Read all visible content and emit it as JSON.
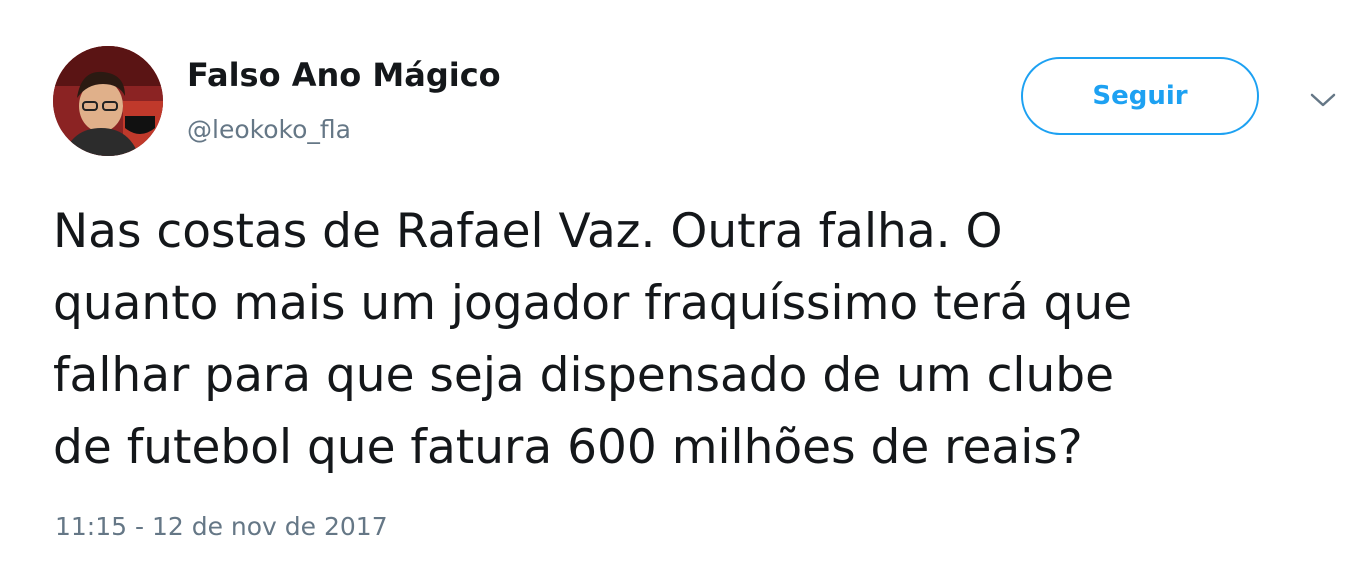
{
  "tweet": {
    "author": {
      "display_name": "Falso Ano Mágico",
      "handle": "@leokoko_fla"
    },
    "follow_label": "Seguir",
    "text_lines": [
      "Nas costas de Rafael Vaz. Outra falha. O",
      "quanto mais um jogador fraquíssimo terá que",
      "falhar para que seja dispensado de um clube",
      "de futebol que fatura 600 milhões de reais?"
    ],
    "timestamp": "11:15 - 12 de nov de 2017"
  },
  "icons": {
    "menu": "chevron-down-icon",
    "avatar": "profile-photo"
  },
  "colors": {
    "accent": "#1da1f2",
    "text": "#14171a",
    "secondary_text": "#657786"
  }
}
